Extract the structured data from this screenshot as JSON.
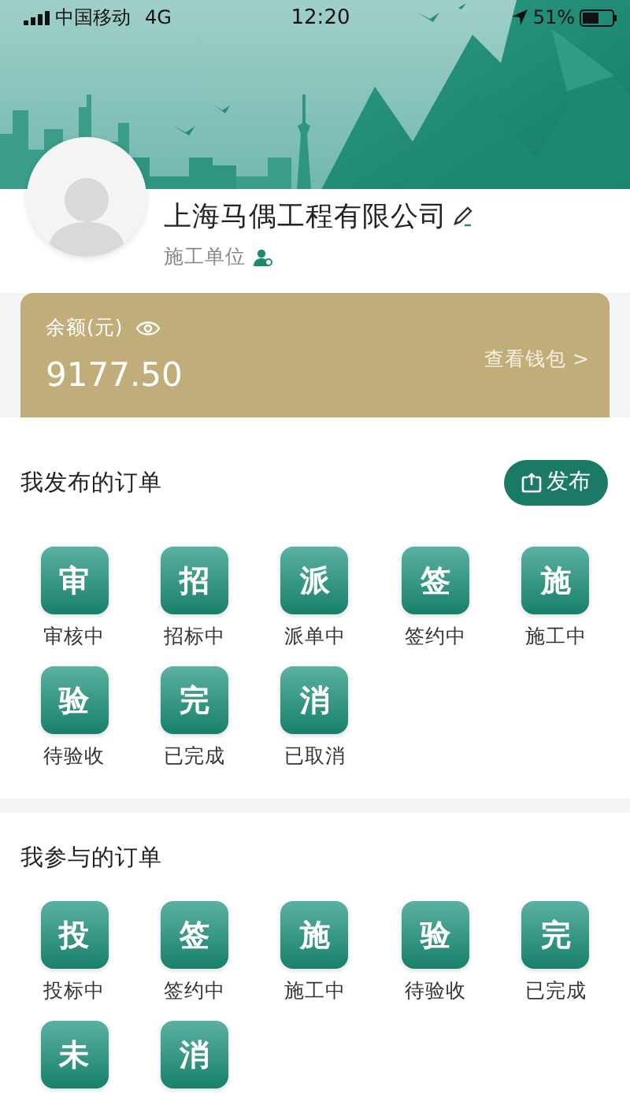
{
  "status_bar": {
    "carrier": "中国移动",
    "network": "4G",
    "time": "12:20",
    "battery": "51%"
  },
  "profile": {
    "company_name": "上海马偶工程有限公司",
    "role": "施工单位"
  },
  "wallet": {
    "label": "余额(元)",
    "amount": "9177.50",
    "link": "查看钱包 >"
  },
  "sections": [
    {
      "title": "我发布的订单",
      "button": "发布",
      "items": [
        {
          "glyph": "审",
          "label": "审核中"
        },
        {
          "glyph": "招",
          "label": "招标中"
        },
        {
          "glyph": "派",
          "label": "派单中"
        },
        {
          "glyph": "签",
          "label": "签约中"
        },
        {
          "glyph": "施",
          "label": "施工中"
        },
        {
          "glyph": "验",
          "label": "待验收"
        },
        {
          "glyph": "完",
          "label": "已完成"
        },
        {
          "glyph": "消",
          "label": "已取消"
        }
      ]
    },
    {
      "title": "我参与的订单",
      "items": [
        {
          "glyph": "投",
          "label": "投标中"
        },
        {
          "glyph": "签",
          "label": "签约中"
        },
        {
          "glyph": "施",
          "label": "施工中"
        },
        {
          "glyph": "验",
          "label": "待验收"
        },
        {
          "glyph": "完",
          "label": "已完成"
        },
        {
          "glyph": "未"
        },
        {
          "glyph": "消"
        }
      ]
    }
  ]
}
